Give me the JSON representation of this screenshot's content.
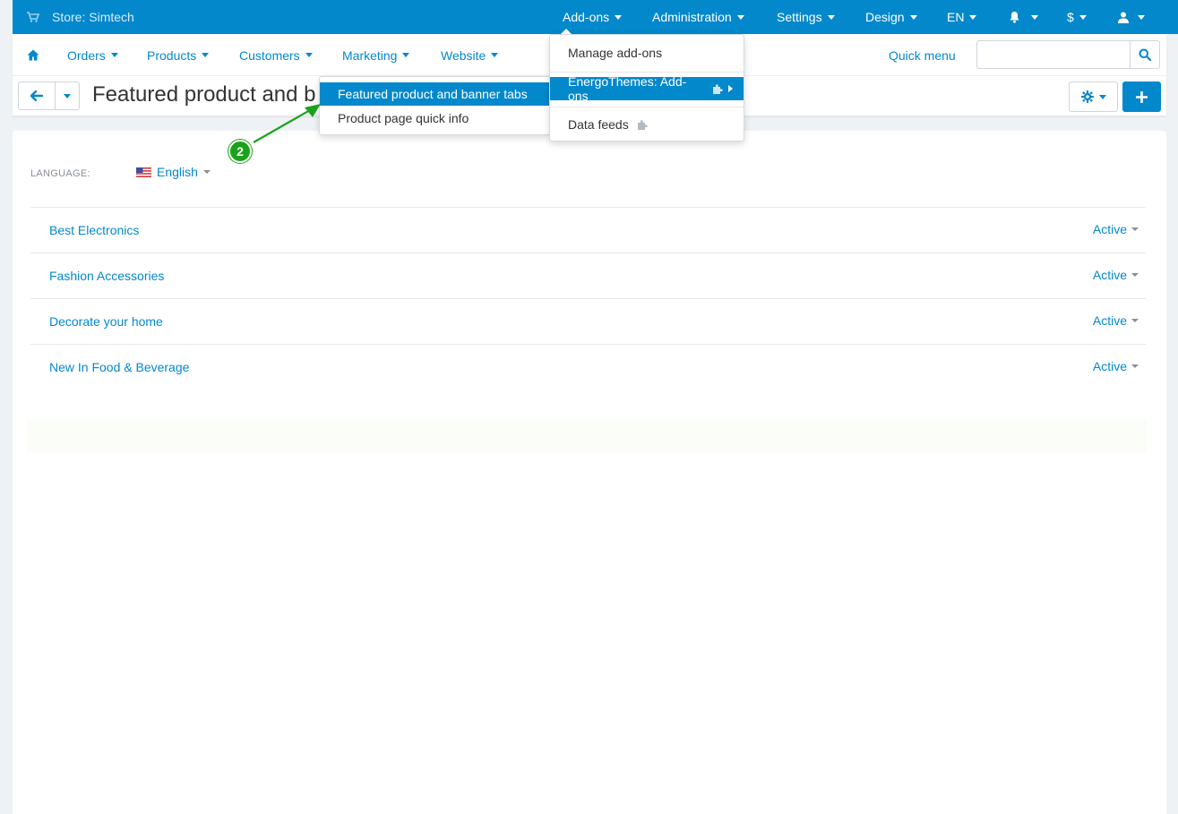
{
  "topbar": {
    "store_label": "Store: Simtech",
    "addons": "Add-ons",
    "administration": "Administration",
    "settings": "Settings",
    "design": "Design",
    "language": "EN",
    "currency": "$"
  },
  "menu": {
    "orders": "Orders",
    "products": "Products",
    "customers": "Customers",
    "marketing": "Marketing",
    "website": "Website",
    "quick_menu": "Quick menu",
    "search_value": ""
  },
  "page": {
    "title": "Featured product and b"
  },
  "language": {
    "label": "LANGUAGE:",
    "selected": "English"
  },
  "rows": [
    {
      "name": "Best Electronics",
      "status": "Active"
    },
    {
      "name": "Fashion Accessories",
      "status": "Active"
    },
    {
      "name": "Decorate your home",
      "status": "Active"
    },
    {
      "name": "New In Food & Beverage",
      "status": "Active"
    }
  ],
  "addons_menu": {
    "manage": "Manage add-ons",
    "energo": "EnergoThemes: Add-ons",
    "data_feeds": "Data feeds"
  },
  "submenu": {
    "item1": "Featured product and banner tabs",
    "item2": "Product page quick info"
  },
  "annotation": {
    "badge": "2"
  },
  "colors": {
    "brand": "#0388cc",
    "annotation": "#1aa31a"
  }
}
